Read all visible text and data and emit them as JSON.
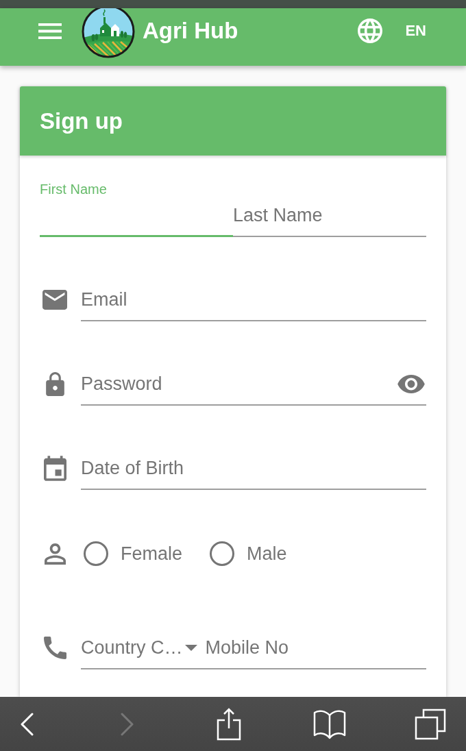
{
  "app_bar": {
    "title": "Agri Hub",
    "language": "EN"
  },
  "signup_form": {
    "title": "Sign up",
    "rows": [
      {
        "kind": "name",
        "fields": [
          {
            "label": "First Name",
            "focused": true
          },
          {
            "label": "Last Name",
            "focused": false
          }
        ]
      },
      {
        "kind": "email",
        "placeholder": "Email"
      },
      {
        "kind": "password",
        "placeholder": "Password"
      },
      {
        "kind": "date",
        "placeholder": "Date of Birth"
      },
      {
        "kind": "gender",
        "options": [
          {
            "label": "Female",
            "selected": false
          },
          {
            "label": "Male",
            "selected": false
          }
        ]
      },
      {
        "kind": "phone",
        "country_code": "Country C…",
        "placeholder": "Mobile No"
      }
    ]
  },
  "browser_toolbar": {
    "back": {
      "disabled": false
    },
    "forward": {
      "disabled": true
    }
  }
}
